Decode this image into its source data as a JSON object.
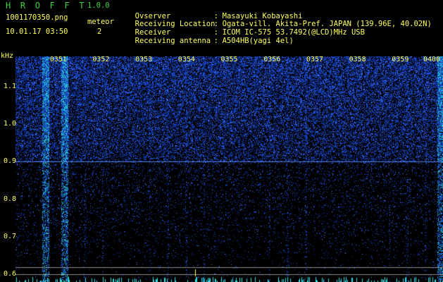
{
  "app": {
    "title": "H R O F F T",
    "version": "1.0.0"
  },
  "file": {
    "name": "1001170350.png",
    "datetime": "10.01.17 03:50"
  },
  "meteor": {
    "label": "meteor",
    "count": "2"
  },
  "info": [
    {
      "key": "Ovserver",
      "value": "Masayuki Kobayashi"
    },
    {
      "key": "Receiving Location",
      "value": "Ogata-vill. Akita-Pref. JAPAN (139.96E, 40.02N)"
    },
    {
      "key": "Receiver",
      "value": "ICOM IC-575 53.7492(@LCD)MHz USB"
    },
    {
      "key": "Receiving antenna",
      "value": "A504HB(yagi 4el)"
    }
  ],
  "info_sep": ":",
  "axis": {
    "unit": "kHz"
  },
  "colors": {
    "text": "#ffff5a",
    "title": "#37d23a",
    "signal": "#1e46ff"
  },
  "chart_data": {
    "type": "heatmap",
    "x_ticks": [
      "0351",
      "0352",
      "0353",
      "0354",
      "0355",
      "0356",
      "0357",
      "0358",
      "0359",
      "0400"
    ],
    "y_ticks": [
      "1.1",
      "1.0",
      "0.9",
      "0.8",
      "0.7",
      "0.6"
    ],
    "ylim": [
      0.58,
      1.18
    ],
    "xlim": [
      "03:50",
      "04:00"
    ],
    "grid": false,
    "horizontal_lines": [
      0.9,
      0.62,
      0.6
    ],
    "bright_columns_min": [
      0.7,
      1.15,
      9.95
    ]
  }
}
